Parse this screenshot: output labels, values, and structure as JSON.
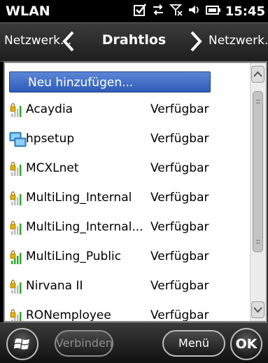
{
  "status_bar": {
    "title": "WLAN",
    "time": "15:45",
    "icons": [
      "checkbox-icon",
      "data-transfer-icon",
      "no-signal-icon",
      "speaker-icon",
      "battery-icon"
    ]
  },
  "header": {
    "prev_tab": "Netzwerk...",
    "current_tab": "Drahtlos",
    "next_tab": "Netzwerk..."
  },
  "networks": {
    "add_button": "Neu hinzufügen...",
    "items": [
      {
        "name": "Acaydia",
        "status": "Verfügbar",
        "icon": "secured-wifi-icon"
      },
      {
        "name": "hpsetup",
        "status": "Verfügbar",
        "icon": "adhoc-network-icon"
      },
      {
        "name": "MCXLnet",
        "status": "Verfügbar",
        "icon": "secured-wifi-icon"
      },
      {
        "name": "MultiLing_Internal",
        "status": "Verfügbar",
        "icon": "secured-wifi-icon"
      },
      {
        "name": "MultiLing_Internal...",
        "status": "Verfügbar",
        "icon": "secured-wifi-icon"
      },
      {
        "name": "MultiLing_Public",
        "status": "Verfügbar",
        "icon": "secured-wifi-strong-icon"
      },
      {
        "name": "Nirvana II",
        "status": "Verfügbar",
        "icon": "secured-wifi-icon"
      },
      {
        "name": "RONemployee",
        "status": "Verfügbar",
        "icon": "secured-wifi-icon"
      }
    ]
  },
  "bottom_bar": {
    "connect_label": "Verbinden",
    "menu_label": "Menü",
    "ok_label": "OK"
  },
  "colors": {
    "accent": "#2e5cb8",
    "signal_green": "#2fa52f",
    "lock_yellow": "#e0b000"
  }
}
